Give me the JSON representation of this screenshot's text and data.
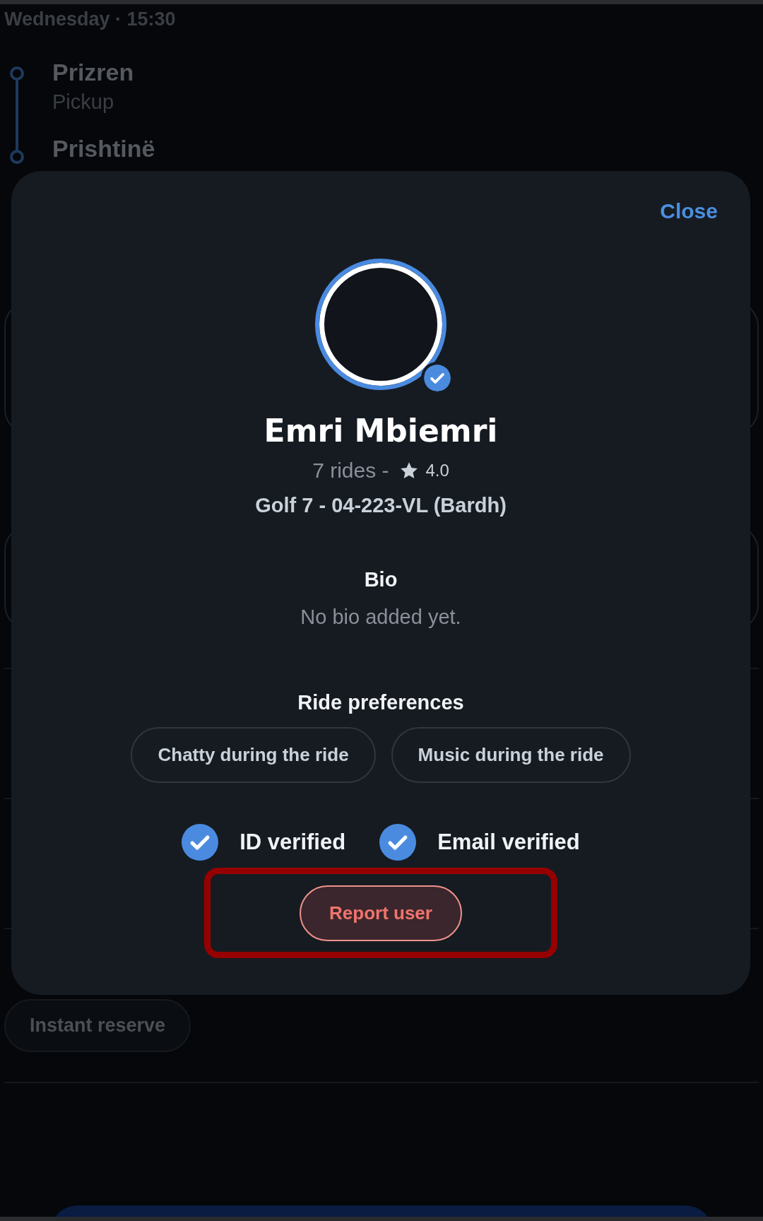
{
  "backdrop": {
    "date_time": "Wednesday · 15:30",
    "route": [
      {
        "place": "Prizren",
        "label": "Pickup"
      },
      {
        "place": "Prishtinë"
      }
    ],
    "chips": [
      "Instant reserve"
    ]
  },
  "profile_modal": {
    "close": "Close",
    "name": "Emri Mbiemri",
    "rides": "7 rides -",
    "rating": "4.0",
    "vehicle": "Golf 7 - 04-223-VL (Bardh)",
    "bio_title": "Bio",
    "bio": "No bio added yet.",
    "preferences_title": "Ride preferences",
    "preferences": [
      "Chatty during the ride",
      "Music during the ride"
    ],
    "verifications": [
      {
        "label": "ID verified"
      },
      {
        "label": "Email verified"
      }
    ],
    "report_button": "Report user",
    "highlighted": true
  }
}
